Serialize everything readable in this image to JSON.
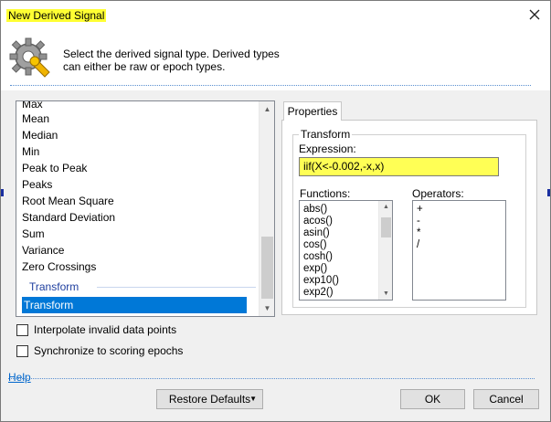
{
  "window": {
    "title": "New Derived Signal",
    "close_glyph": "✕"
  },
  "header": {
    "description": "Select the derived signal type. Derived types can either be raw or epoch types.",
    "icon": "gear-wrench-icon"
  },
  "signal_list": {
    "items": [
      "Max",
      "Mean",
      "Median",
      "Min",
      "Peak to Peak",
      "Peaks",
      "Root Mean Square",
      "Standard Deviation",
      "Sum",
      "Variance",
      "Zero Crossings"
    ],
    "group_label": "Transform",
    "selected": "Transform"
  },
  "options": {
    "interpolate": "Interpolate invalid data points",
    "synchronize": "Synchronize to scoring epochs"
  },
  "properties": {
    "tab_label": "Properties",
    "group_title": "Transform",
    "expression_label": "Expression:",
    "expression_value": "iif(X<-0.002,-x,x)",
    "functions_label": "Functions:",
    "functions": [
      "abs()",
      "acos()",
      "asin()",
      "cos()",
      "cosh()",
      "exp()",
      "exp10()",
      "exp2()",
      "..."
    ],
    "operators_label": "Operators:",
    "operators": [
      "+",
      "-",
      "*",
      "/"
    ]
  },
  "footer": {
    "help": "Help",
    "restore_defaults": "Restore Defaults",
    "ok": "OK",
    "cancel": "Cancel"
  },
  "colors": {
    "highlight": "#ffff33",
    "selection": "#0078d7",
    "group_text": "#1f3f9f"
  }
}
